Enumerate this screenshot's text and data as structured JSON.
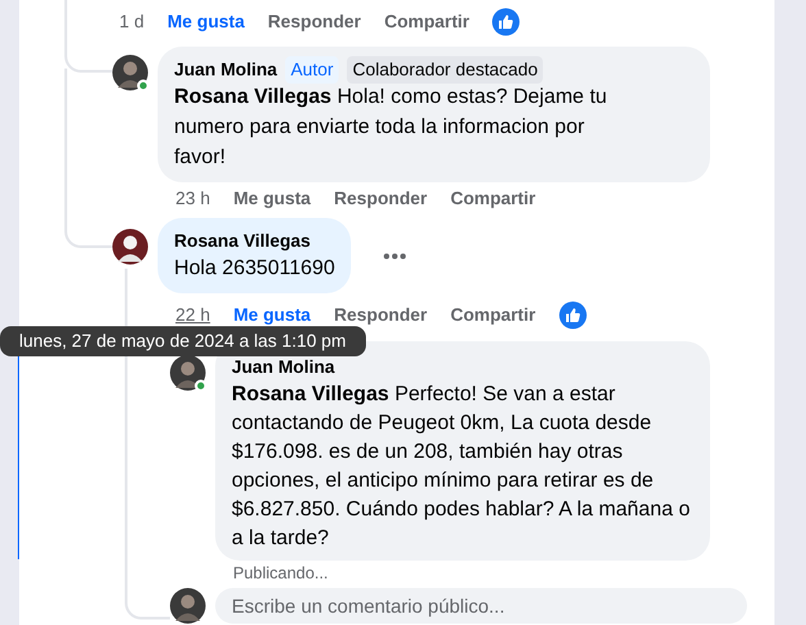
{
  "top_actions": {
    "time": "1 d",
    "like": "Me gusta",
    "liked": true,
    "reply": "Responder",
    "share": "Compartir",
    "reaction": true,
    "time_hovered": false
  },
  "comments": [
    {
      "author": "Juan Molina",
      "online": true,
      "color": "#f0f2f5",
      "badges": [
        {
          "kind": "author",
          "label": "Autor"
        },
        {
          "kind": "contributor",
          "label": "Colaborador destacado"
        }
      ],
      "text": "**Rosana Villegas** Hola! como estas? Dejame tu numero para enviarte toda la informacion por favor!",
      "actions": {
        "time": "23 h",
        "like": "Me gusta",
        "liked": false,
        "reply": "Responder",
        "share": "Compartir",
        "time_hovered": false
      }
    },
    {
      "author": "Rosana Villegas",
      "color": "#e7f3ff",
      "text": "Hola 2635011690",
      "more": true,
      "actions": {
        "time": "22 h",
        "like": "Me gusta",
        "liked": true,
        "reply": "Responder",
        "share": "Compartir",
        "reaction": true,
        "time_hovered": true
      }
    },
    {
      "author": "Juan Molina",
      "online": true,
      "color": "#f0f2f5",
      "text": "**Rosana Villegas** Perfecto! Se van a estar contactando de Peugeot 0km, La cuota desde $176.098. es de un 208, también hay otras opciones, el anticipo mínimo para retirar es de $6.827.850. Cuándo podes hablar? A la mañana o a la tarde?",
      "status": "Publicando..."
    }
  ],
  "tooltip": {
    "text": "lunes, 27 de mayo de 2024 a las 1:10 pm"
  },
  "composer": {
    "placeholder": "Escribe un comentario público..."
  }
}
